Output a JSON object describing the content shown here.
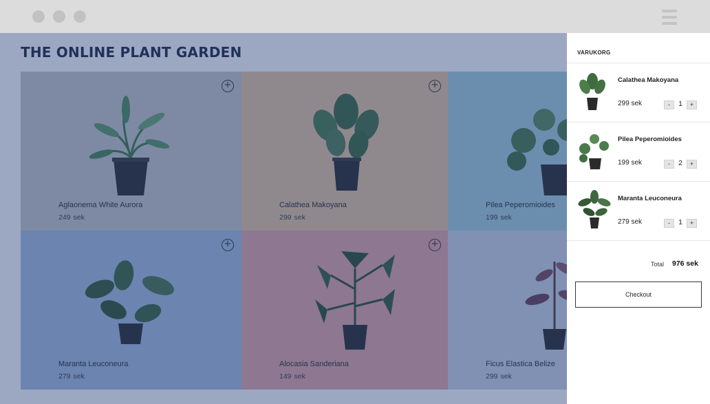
{
  "window": {
    "controls": [
      "close-dot",
      "minimize-dot",
      "maximize-dot"
    ],
    "menu_icon": "hamburger-icon"
  },
  "page": {
    "title": "THE ONLINE PLANT GARDEN"
  },
  "colors": {
    "card_grey": "#c9c9c9",
    "card_tan": "#e8c7a0",
    "card_teal": "#a7cfdc",
    "card_blue": "#a7bddf",
    "card_red": "#e6a7a6",
    "card_lightgrey": "#cdd6e6",
    "overlay": "rgba(36,62,120,0.45)",
    "title": "#1e2744"
  },
  "products": [
    {
      "name": "Aglaonema White Aurora",
      "price": "249",
      "currency": "sek",
      "add_label": "+"
    },
    {
      "name": "Calathea Makoyana",
      "price": "299",
      "currency": "sek",
      "add_label": "+"
    },
    {
      "name": "Pilea Peperomioides",
      "price": "199",
      "currency": "sek"
    },
    {
      "name": "Maranta Leuconeura",
      "price": "279",
      "currency": "sek",
      "add_label": "+"
    },
    {
      "name": "Alocasia Sanderiana",
      "price": "149",
      "currency": "sek",
      "add_label": "+"
    },
    {
      "name": "Ficus Elastica Belize",
      "price": "299",
      "currency": "sek"
    }
  ],
  "cart": {
    "title": "VARUKORG",
    "items": [
      {
        "name": "Calathea Makoyana",
        "price": "299 sek",
        "quantity": "1",
        "minus_label": "-",
        "plus_label": "+"
      },
      {
        "name": "Pilea Peperomioides",
        "price": "199 sek",
        "quantity": "2",
        "minus_label": "-",
        "plus_label": "+"
      },
      {
        "name": "Maranta Leuconeura",
        "price": "279 sek",
        "quantity": "1",
        "minus_label": "-",
        "plus_label": "+"
      }
    ],
    "total_label": "Total",
    "total_value": "976 sek",
    "checkout_label": "Checkout"
  }
}
